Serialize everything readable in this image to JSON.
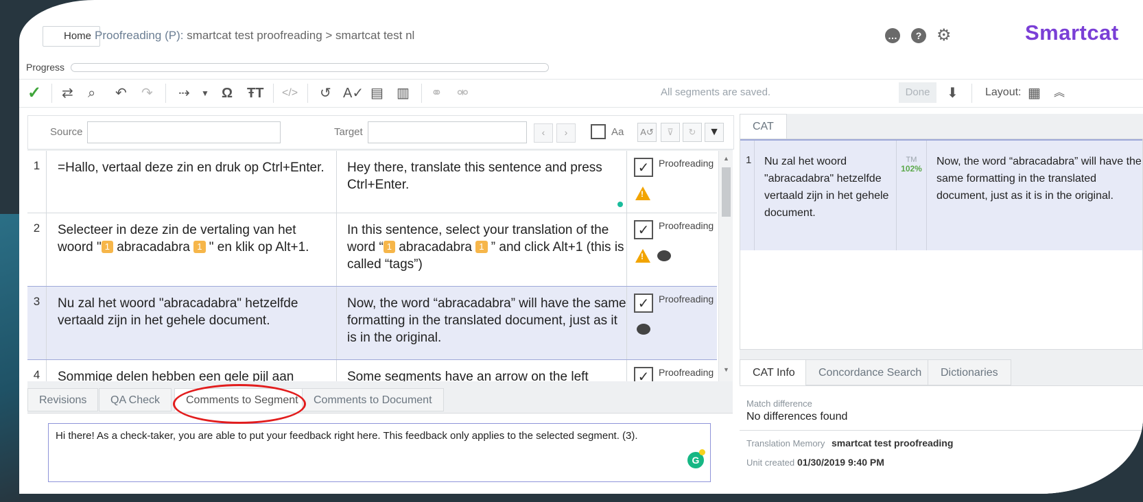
{
  "header": {
    "home_label": "Home",
    "breadcrumb_prefix": "Proofreading (P):",
    "breadcrumb_rest": "smartcat test proofreading > smartcat test nl",
    "logo": "Smartcat"
  },
  "progress": {
    "label": "Progress",
    "value": 0
  },
  "toolbar": {
    "status_text": "All segments are saved.",
    "done_label": "Done",
    "layout_label": "Layout:"
  },
  "filter": {
    "source_label": "Source",
    "target_label": "Target",
    "case_label": "Aa",
    "source_value": "",
    "target_value": ""
  },
  "segments": [
    {
      "num": "1",
      "source": "=Hallo, vertaal deze zin en druk op Ctrl+Enter.",
      "target": "Hey there, translate this sentence and press Ctrl+Enter.",
      "status": "Proofreading"
    },
    {
      "num": "2",
      "source_a": "Selecteer in deze zin de vertaling van het woord \"",
      "source_tag1": "1",
      "source_word": " abracadabra ",
      "source_tag2": "1",
      "source_b": " \" en klik op Alt+1.",
      "target_a": "In this sentence, select your translation of the word “",
      "target_tag1": "1",
      "target_word": " abracadabra ",
      "target_tag2": "1",
      "target_b": " ” and click Alt+1 (this is called “tags”)",
      "status": "Proofreading"
    },
    {
      "num": "3",
      "source": "Nu zal het woord \"abracadabra\" hetzelfde vertaald zijn in het gehele document.",
      "target": "Now, the word “abracadabra” will have the same formatting in the translated document, just as it is in the original.",
      "status": "Proofreading"
    },
    {
      "num": "4",
      "source": "Sommige delen hebben een gele pijl aan",
      "target": "Some segments have an arrow on the left",
      "status": "Proofreading"
    }
  ],
  "bottom_tabs": [
    "Revisions",
    "QA Check",
    "Comments to Segment",
    "Comments to Document"
  ],
  "comment_text": "Hi there! As a check-taker, you are able to put your feedback right here. This feedback only applies to the selected segment. (3).",
  "cat": {
    "tab_label": "CAT",
    "num": "1",
    "source": "Nu zal het woord \"abracadabra\" hetzelfde vertaald zijn in het gehele document.",
    "tm_label": "TM",
    "match": "102%",
    "target": "Now, the word “abracadabra” will have the same formatting in the translated document, just as it is in the original."
  },
  "right_tabs": [
    "CAT Info",
    "Concordance Search",
    "Dictionaries"
  ],
  "cat_info": {
    "match_diff_label": "Match difference",
    "match_diff_value": "No differences found",
    "tm_label": "Translation Memory",
    "tm_value": "smartcat test proofreading",
    "created_label": "Unit created",
    "created_value": "01/30/2019 9:40 PM"
  },
  "colors": {
    "accent": "#7a3fd6",
    "selected_row": "#e7eaf7",
    "warning": "#f2a400",
    "tag": "#f6b64a",
    "highlight": "#e21d1d"
  }
}
